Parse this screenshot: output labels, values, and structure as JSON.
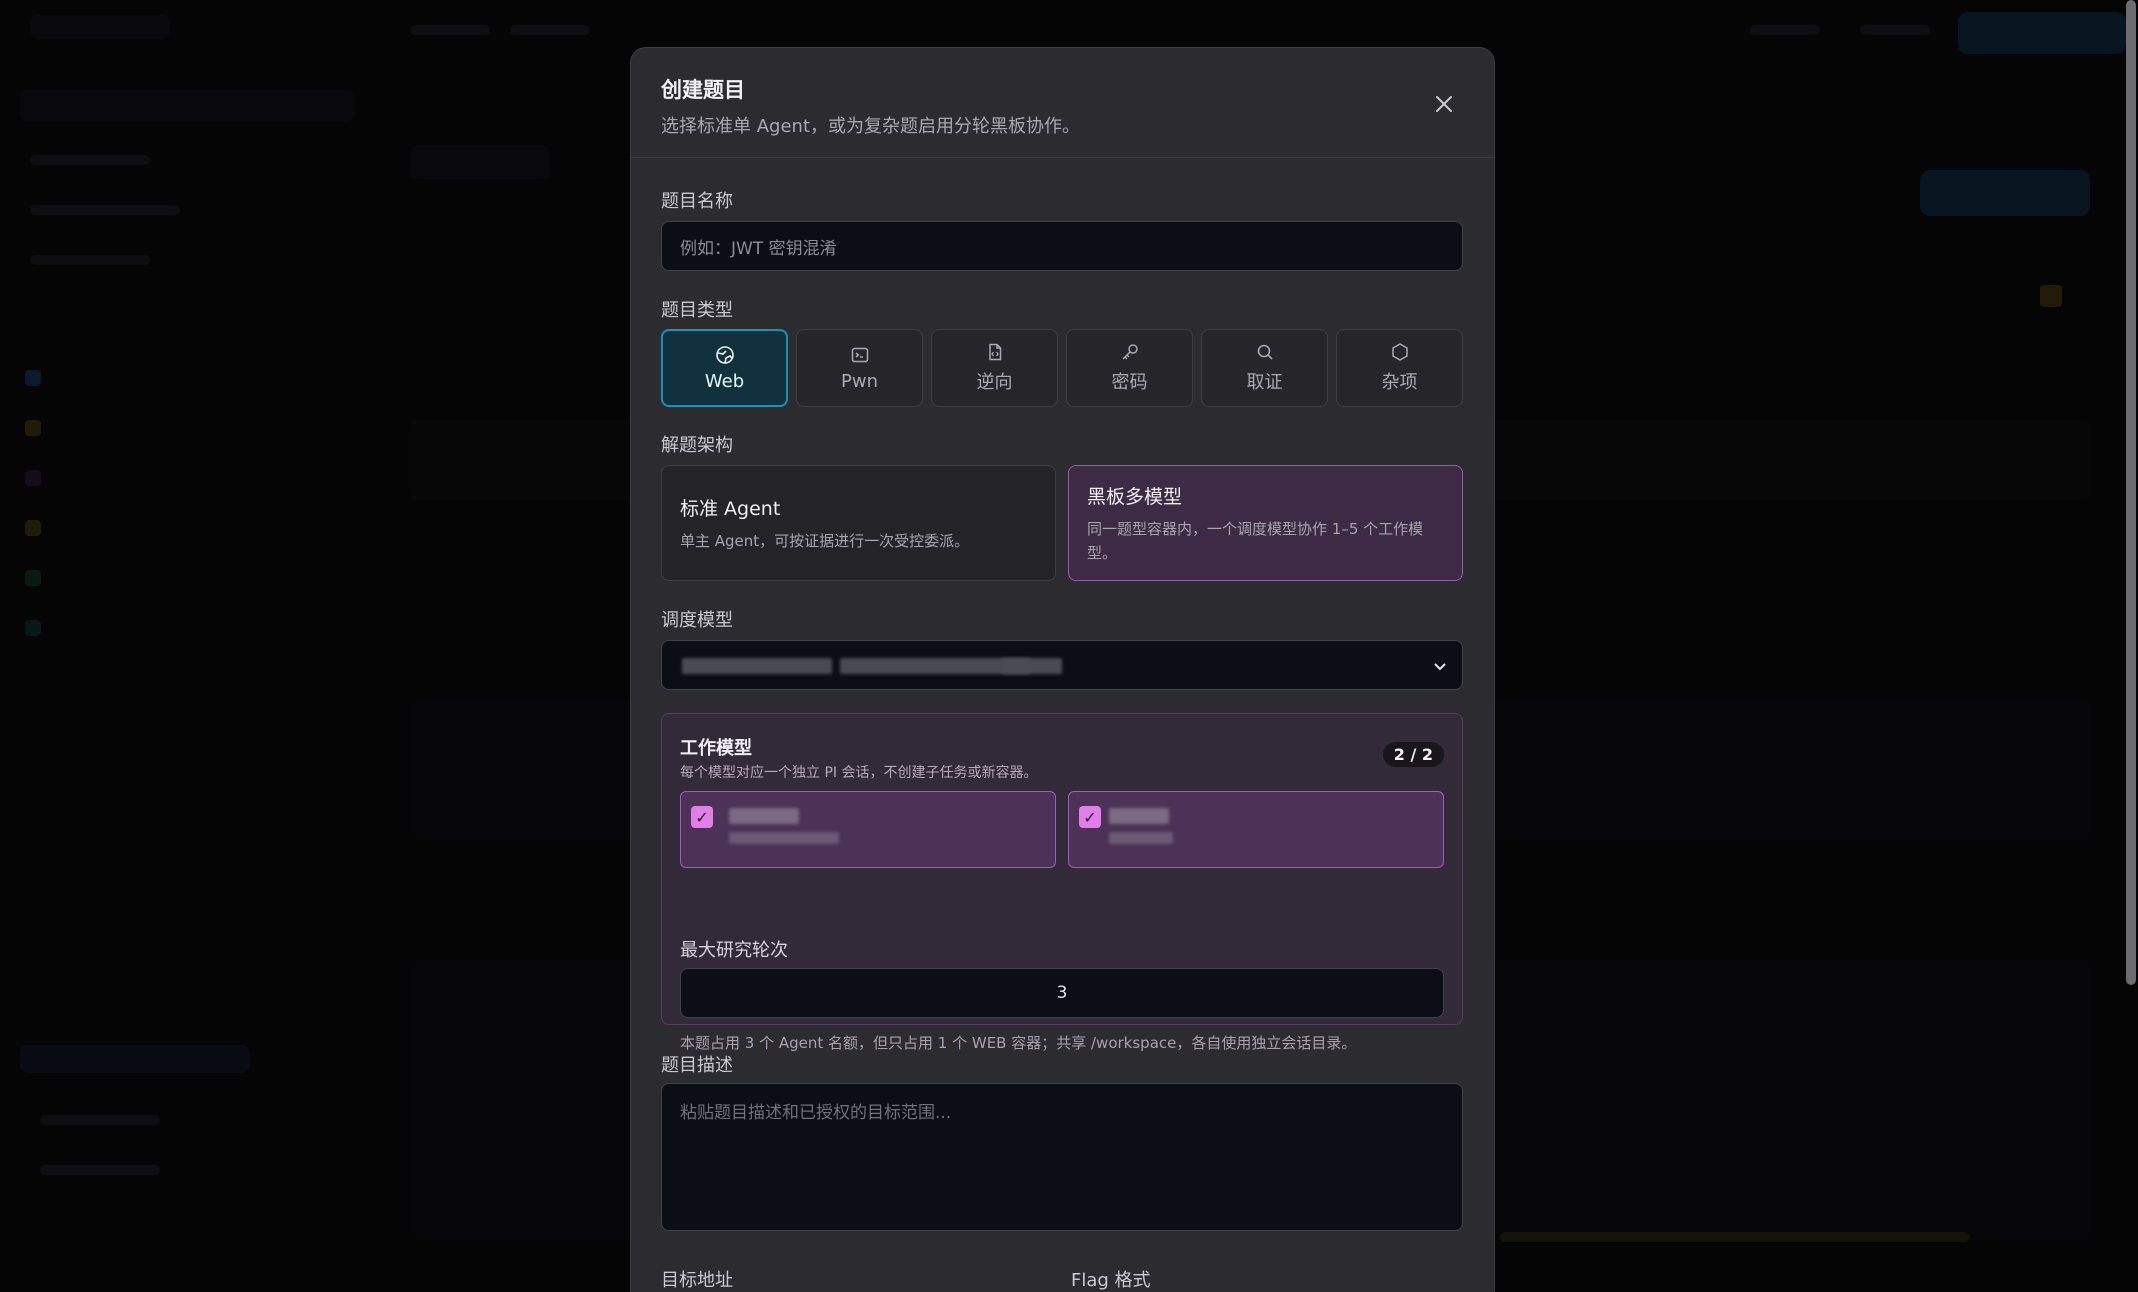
{
  "modal": {
    "title": "创建题目",
    "subtitle": "选择标准单 Agent，或为复杂题启用分轮黑板协作。"
  },
  "name_field": {
    "label": "题目名称",
    "placeholder": "例如：JWT 密钥混淆"
  },
  "type_field": {
    "label": "题目类型",
    "options": [
      {
        "label": "Web",
        "icon": "globe-icon",
        "selected": true
      },
      {
        "label": "Pwn",
        "icon": "terminal-icon",
        "selected": false
      },
      {
        "label": "逆向",
        "icon": "file-code-icon",
        "selected": false
      },
      {
        "label": "密码",
        "icon": "key-icon",
        "selected": false
      },
      {
        "label": "取证",
        "icon": "search-icon",
        "selected": false
      },
      {
        "label": "杂项",
        "icon": "hexagon-icon",
        "selected": false
      }
    ]
  },
  "arch_field": {
    "label": "解题架构",
    "options": [
      {
        "title": "标准 Agent",
        "desc": "单主 Agent，可按证据进行一次受控委派。",
        "selected": false
      },
      {
        "title": "黑板多模型",
        "desc": "同一题型容器内，一个调度模型协作 1–5 个工作模型。",
        "selected": true
      }
    ]
  },
  "scheduler_field": {
    "label": "调度模型"
  },
  "workers": {
    "title": "工作模型",
    "subtitle": "每个模型对应一个独立 PI 会话，不创建子任务或新容器。",
    "count": "2 / 2",
    "check_mark": "✓",
    "rounds_label": "最大研究轮次",
    "rounds_value": "3",
    "note": "本题占用 3 个 Agent 名额，但只占用 1 个 WEB 容器；共享 /workspace，各自使用独立会话目录。"
  },
  "desc_field": {
    "label": "题目描述",
    "placeholder": "粘贴题目描述和已授权的目标范围..."
  },
  "target_field": {
    "label": "目标地址"
  },
  "flag_field": {
    "label": "Flag 格式"
  },
  "colors": {
    "accent_blue": "#1f8fb4",
    "accent_purple": "#9a59b5",
    "checkbox_pink": "#e27ee9"
  }
}
